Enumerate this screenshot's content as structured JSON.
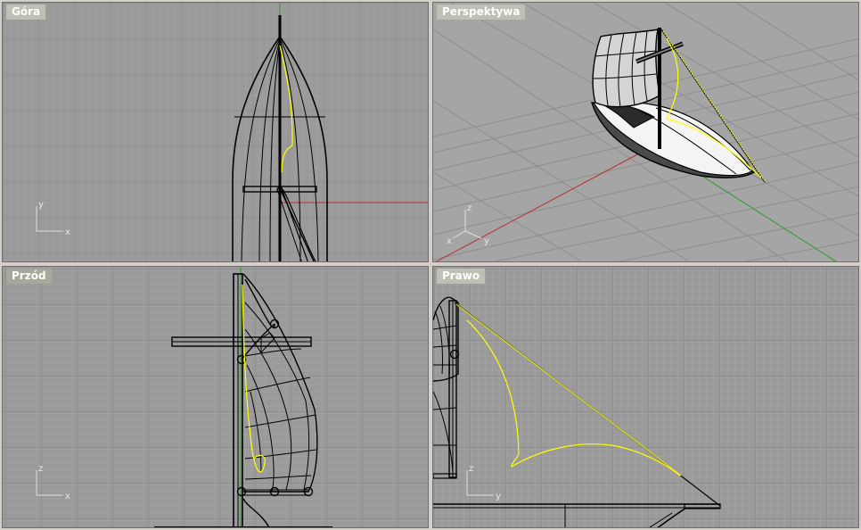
{
  "viewports": [
    {
      "id": "top",
      "label": "Góra",
      "active": false,
      "axes": [
        "y",
        "x"
      ]
    },
    {
      "id": "perspective",
      "label": "Perspektywa",
      "active": false,
      "axes": [
        "z",
        "x",
        "y"
      ]
    },
    {
      "id": "front",
      "label": "Przód",
      "active": true,
      "axes": [
        "z",
        "x"
      ]
    },
    {
      "id": "right",
      "label": "Prawo",
      "active": false,
      "axes": [
        "z",
        "y"
      ]
    }
  ],
  "colors": {
    "viewport_bg": "#9a9a9a",
    "grid_minor": "#a6a6a6",
    "grid_major": "#868686",
    "axis_x": "#b83030",
    "axis_y": "#2f9a2f",
    "curve_selected": "#ffff00",
    "wire": "#000000",
    "frame": "#d4d0c8"
  },
  "icons": [
    "axis-triad-icon"
  ]
}
